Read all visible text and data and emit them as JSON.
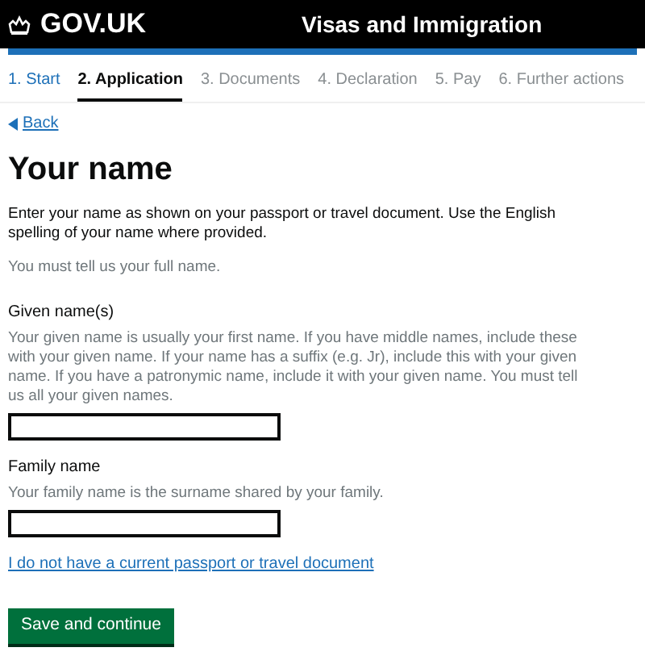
{
  "header": {
    "logo": "GOV.UK",
    "service": "Visas and Immigration"
  },
  "steps": [
    {
      "label": "1. Start",
      "completed": true,
      "selected": false
    },
    {
      "label": "2. Application",
      "completed": false,
      "selected": true
    },
    {
      "label": "3. Documents",
      "completed": false,
      "selected": false
    },
    {
      "label": "4. Declaration",
      "completed": false,
      "selected": false
    },
    {
      "label": "5. Pay",
      "completed": false,
      "selected": false
    },
    {
      "label": "6. Further actions",
      "completed": false,
      "selected": false
    }
  ],
  "back_link": "Back",
  "title": "Your name",
  "intro": "Enter your name as shown on your passport or travel document. Use the English spelling of your name where provided.",
  "note": "You must tell us your full name.",
  "fields": [
    {
      "label": "Given name(s)",
      "hint": "Your given name is usually your first name. If you have middle names, include these with your given name. If your name has a suffix (e.g. Jr), include this with your given name. If you have a patronymic name, include it with your given name. You must tell us all your given names."
    },
    {
      "label": "Family name",
      "hint": "Your family name is the surname shared by your family."
    }
  ],
  "link": "I do not have a current passport or travel document",
  "button": "Save and continue"
}
